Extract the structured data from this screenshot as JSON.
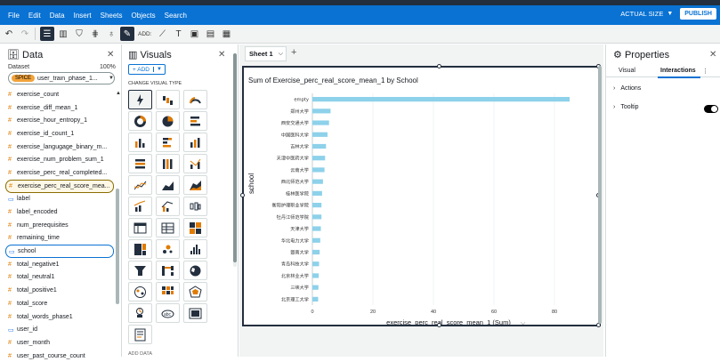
{
  "menu": [
    "File",
    "Edit",
    "Data",
    "Insert",
    "Sheets",
    "Objects",
    "Search"
  ],
  "header": {
    "size_label": "ACTUAL SIZE",
    "publish_label": "PUBLISH"
  },
  "toolbar": {
    "add_label": "ADD:"
  },
  "data_panel": {
    "title": "Data",
    "dataset_label": "Dataset",
    "dataset_pct": "100%",
    "spice_badge": "SPICE",
    "dataset_name": "user_train_phase_1...",
    "fields": [
      {
        "name": "exercise_count",
        "kind": "measure"
      },
      {
        "name": "exercise_diff_mean_1",
        "kind": "measure"
      },
      {
        "name": "exercise_hour_entropy_1",
        "kind": "measure"
      },
      {
        "name": "exercise_id_count_1",
        "kind": "measure"
      },
      {
        "name": "exercise_langugage_binary_m...",
        "kind": "measure"
      },
      {
        "name": "exercise_num_problem_sum_1",
        "kind": "measure"
      },
      {
        "name": "exercise_perc_real_completed...",
        "kind": "measure"
      },
      {
        "name": "exercise_perc_real_score_mea...",
        "kind": "measure",
        "selected": true
      },
      {
        "name": "label",
        "kind": "dimension"
      },
      {
        "name": "label_encoded",
        "kind": "measure"
      },
      {
        "name": "num_prerequisites",
        "kind": "measure"
      },
      {
        "name": "remaining_time",
        "kind": "measure"
      },
      {
        "name": "school",
        "kind": "dimension",
        "selected": true
      },
      {
        "name": "total_negative1",
        "kind": "measure"
      },
      {
        "name": "total_neutral1",
        "kind": "measure"
      },
      {
        "name": "total_positive1",
        "kind": "measure"
      },
      {
        "name": "total_score",
        "kind": "measure"
      },
      {
        "name": "total_words_phase1",
        "kind": "measure"
      },
      {
        "name": "user_id",
        "kind": "dimension"
      },
      {
        "name": "user_month",
        "kind": "measure"
      },
      {
        "name": "user_past_course_count",
        "kind": "measure"
      }
    ]
  },
  "visuals_panel": {
    "title": "Visuals",
    "add_label": "+ ADD",
    "change_type_label": "CHANGE VISUAL TYPE",
    "add_data_label": "ADD DATA"
  },
  "canvas": {
    "sheet_name": "Sheet 1"
  },
  "properties": {
    "title": "Properties",
    "tabs": [
      "Visual",
      "Interactions"
    ],
    "active_tab": "Interactions",
    "rows": [
      "Actions",
      "Tooltip"
    ]
  },
  "chart_data": {
    "type": "bar",
    "orientation": "horizontal",
    "title": "Sum of Exercise_perc_real_score_mean_1 by School",
    "xlabel": "exercise_perc_real_score_mean_1 (Sum)",
    "ylabel": "school",
    "xlim": [
      0,
      90
    ],
    "xticks": [
      0,
      20,
      40,
      60,
      80
    ],
    "bar_color": "#8dd1ea",
    "categories": [
      "empty",
      "郑州大学",
      "西安交通大学",
      "中国医科大学",
      "吉林大学",
      "天津中医药大学",
      "云南大学",
      "西北师范大学",
      "桂林医学院",
      "衡阳护理职业学院",
      "牡丹江师范学院",
      "天津大学",
      "华北电力大学",
      "暨南大学",
      "青岛科技大学",
      "北京林业大学",
      "三峡大学",
      "北京理工大学"
    ],
    "values": [
      85,
      6,
      5.5,
      5,
      4.5,
      4.2,
      4,
      3.5,
      3.2,
      3,
      3,
      2.8,
      2.6,
      2.4,
      2.2,
      2.1,
      2.0,
      1.9
    ]
  }
}
